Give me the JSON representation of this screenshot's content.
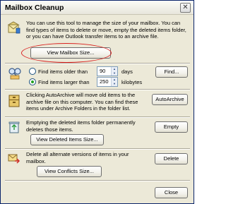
{
  "window": {
    "title": "Mailbox Cleanup",
    "close_glyph": "✕"
  },
  "sections": {
    "mailbox_size": {
      "icon": "mailbox-cleanup-icon",
      "description": "You can use this tool to manage the size of your mailbox. You can find types of items to delete or move, empty the deleted items folder, or you can have Outlook transfer items to an archive file.",
      "button_label": "View Mailbox Size..."
    },
    "find": {
      "icon": "find-items-icon",
      "option_older": {
        "label": "Find items older than",
        "value": "90",
        "unit": "days",
        "checked": false
      },
      "option_larger": {
        "label": "Find items larger than",
        "value": "250",
        "unit": "kilobytes",
        "checked": true
      },
      "button_label": "Find..."
    },
    "autoarchive": {
      "icon": "autoarchive-icon",
      "description": "Clicking AutoArchive will move old items to the archive file on this computer. You can find these items under Archive Folders in the folder list.",
      "button_label": "AutoArchive"
    },
    "deleted_items": {
      "icon": "recycle-bin-icon",
      "description": "Emptying the deleted items folder permanently deletes those items.",
      "view_button_label": "View Deleted Items Size...",
      "empty_button_label": "Empty"
    },
    "conflicts": {
      "icon": "conflicts-icon",
      "description": "Delete all alternate versions of items in your mailbox.",
      "view_button_label": "View Conflicts Size...",
      "delete_button_label": "Delete"
    }
  },
  "footer": {
    "close_label": "Close"
  },
  "colors": {
    "highlight": "#d9201f",
    "radio_dot": "#21a121"
  }
}
